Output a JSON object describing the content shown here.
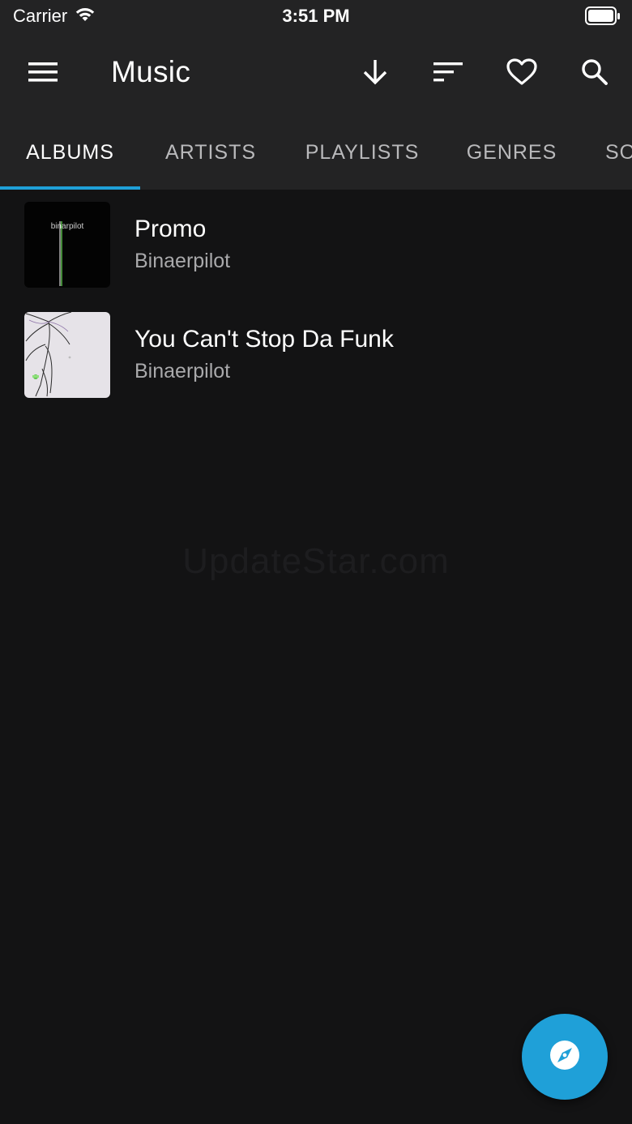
{
  "status_bar": {
    "carrier": "Carrier",
    "time": "3:51 PM"
  },
  "app_bar": {
    "title": "Music",
    "actions": [
      "menu-icon",
      "download-icon",
      "sort-icon",
      "heart-icon",
      "search-icon"
    ]
  },
  "tabs": [
    {
      "label": "ALBUMS",
      "active": true
    },
    {
      "label": "ARTISTS",
      "active": false
    },
    {
      "label": "PLAYLISTS",
      "active": false
    },
    {
      "label": "GENRES",
      "active": false
    },
    {
      "label": "SO",
      "active": false
    }
  ],
  "albums": [
    {
      "title": "Promo",
      "artist": "Binaerpilot",
      "cover_text": "binarpilot"
    },
    {
      "title": "You Can't Stop Da Funk",
      "artist": "Binaerpilot"
    }
  ],
  "watermark": "UpdateStar.com",
  "fab": {
    "icon": "compass-icon"
  },
  "colors": {
    "accent": "#1fa0d8",
    "background": "#131314",
    "appbar": "#232324"
  }
}
